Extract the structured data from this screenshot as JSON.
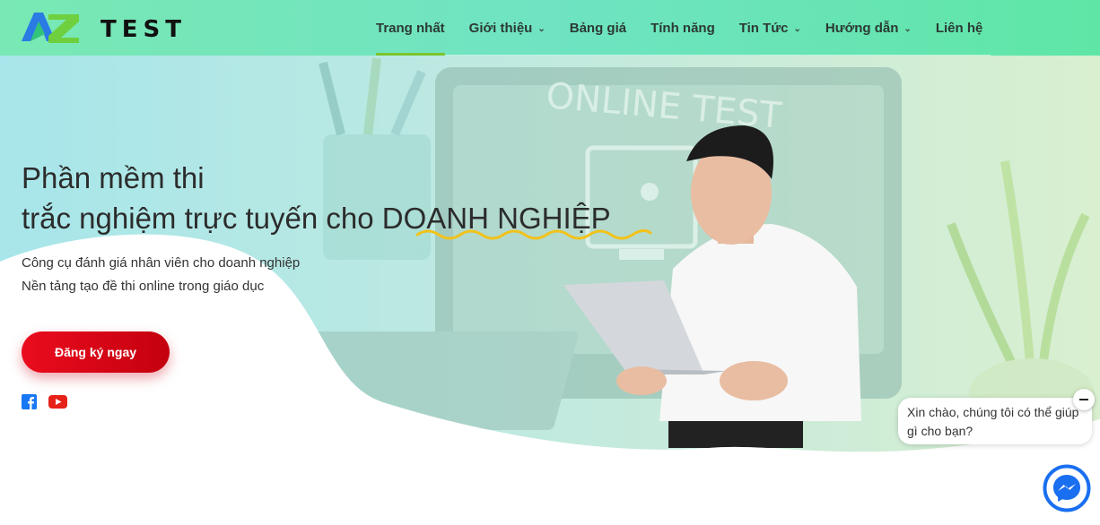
{
  "brand": {
    "logo_text": "TEST"
  },
  "nav": {
    "items": [
      {
        "label": "Trang nhất",
        "has_dropdown": false,
        "active": true
      },
      {
        "label": "Giới thiệu",
        "has_dropdown": true,
        "active": false
      },
      {
        "label": "Bảng giá",
        "has_dropdown": false,
        "active": false
      },
      {
        "label": "Tính năng",
        "has_dropdown": false,
        "active": false
      },
      {
        "label": "Tin Tức",
        "has_dropdown": true,
        "active": false
      },
      {
        "label": "Hướng dẫn",
        "has_dropdown": true,
        "active": false
      },
      {
        "label": "Liên hệ",
        "has_dropdown": false,
        "active": false
      }
    ]
  },
  "hero": {
    "title_line1": "Phần mềm thi",
    "title_line2_prefix": "trắc nghiệm trực tuyến cho ",
    "title_line2_highlight": "DOANH NGHIỆP",
    "image_text": "ONLINE TEST",
    "subtitle1": "Công cụ đánh giá nhân viên cho doanh nghiệp",
    "subtitle2": "Nền tảng tạo đề thi online trong giáo dục",
    "cta_label": "Đăng ký ngay"
  },
  "social": {
    "icons": [
      "facebook-icon",
      "youtube-icon"
    ]
  },
  "chat": {
    "greeting": "Xin chào, chúng tôi có thể giúp gì cho bạn?"
  },
  "colors": {
    "header_start": "#79e8b4",
    "header_end": "#5fe6a6",
    "active_underline": "#7bc62e",
    "cta": "#e00a19",
    "wave": "#f2c21a",
    "facebook": "#1877f2",
    "youtube": "#e62117",
    "messenger": "#1a6ff0"
  }
}
